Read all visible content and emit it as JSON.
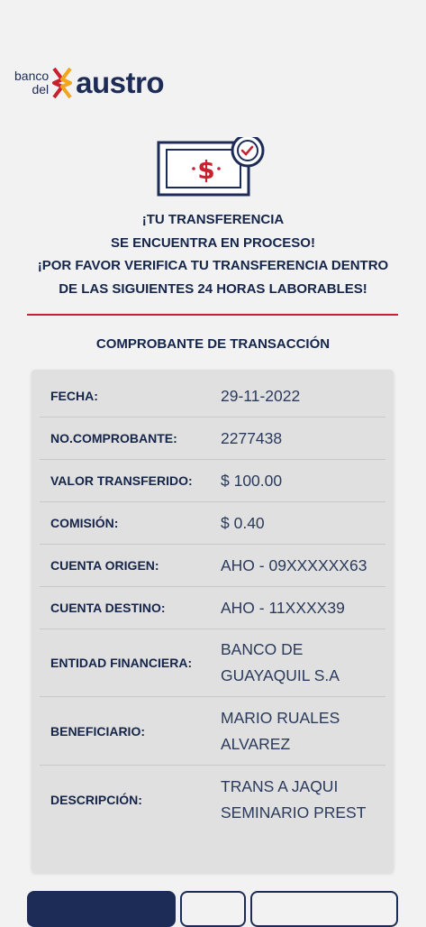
{
  "logo": {
    "small_line1": "banco",
    "small_line2": "del",
    "name": "austro"
  },
  "headline": {
    "line1": "¡TU TRANSFERENCIA",
    "line2": "SE ENCUENTRA EN PROCESO!",
    "line3": "¡POR FAVOR VERIFICA TU TRANSFERENCIA DENTRO",
    "line4": "DE LAS SIGUIENTES 24 HORAS LABORABLES!"
  },
  "section_title": "COMPROBANTE DE TRANSACCIÓN",
  "receipt": [
    {
      "label": "FECHA:",
      "value": [
        "29-11-2022"
      ]
    },
    {
      "label": "NO.COMPROBANTE:",
      "value": [
        "2277438"
      ]
    },
    {
      "label": "VALOR TRANSFERIDO:",
      "value": [
        "$ 100.00"
      ]
    },
    {
      "label": "COMISIÓN:",
      "value": [
        "$ 0.40"
      ]
    },
    {
      "label": "CUENTA ORIGEN:",
      "value": [
        "AHO - 09XXXXXX63"
      ]
    },
    {
      "label": "CUENTA DESTINO:",
      "value": [
        "AHO - 11XXXX39"
      ]
    },
    {
      "label": "ENTIDAD FINANCIERA:",
      "value": [
        "BANCO DE",
        "GUAYAQUIL S.A"
      ]
    },
    {
      "label": "BENEFICIARIO:",
      "value": [
        "MARIO RUALES",
        "ALVAREZ"
      ]
    },
    {
      "label": "DESCRIPCIÓN:",
      "value": [
        "TRANS A JAQUI",
        "SEMINARIO PREST"
      ]
    }
  ],
  "colors": {
    "brand_navy": "#1d2b57",
    "accent_red": "#c8202f",
    "accent_orange": "#f2a51c",
    "card_bg": "#e0e0e0"
  },
  "icons": {
    "illustration": "money-bill-clock-icon",
    "logo_mark": "bank-logo-icon"
  }
}
